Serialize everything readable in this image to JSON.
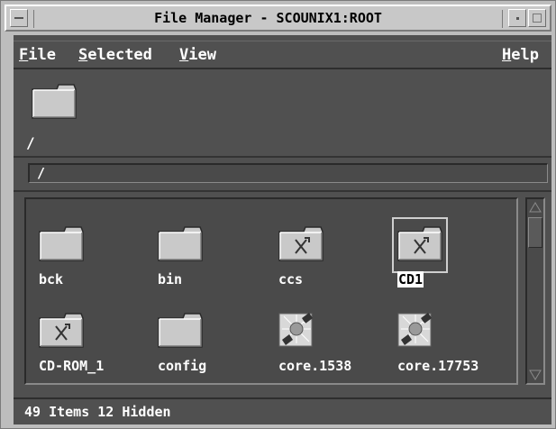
{
  "window": {
    "title": "File Manager - SCOUNIX1:ROOT"
  },
  "menubar": {
    "items": [
      {
        "label": "File",
        "mnemonic": "F",
        "rest": "ile"
      },
      {
        "label": "Selected",
        "mnemonic": "S",
        "rest": "elected"
      },
      {
        "label": "View",
        "mnemonic": "V",
        "rest": "iew"
      },
      {
        "label": "Help",
        "mnemonic": "H",
        "rest": "elp"
      }
    ]
  },
  "location": {
    "current_dir_label": "/",
    "path_value": "/"
  },
  "files": [
    {
      "name": "bck",
      "icon": "folder-icon"
    },
    {
      "name": "bin",
      "icon": "folder-icon"
    },
    {
      "name": "ccs",
      "icon": "linked-folder-icon"
    },
    {
      "name": "CD1",
      "icon": "linked-folder-icon",
      "selected": true
    },
    {
      "name": "CD-ROM_1",
      "icon": "linked-folder-icon"
    },
    {
      "name": "config",
      "icon": "folder-icon"
    },
    {
      "name": "core.1538",
      "icon": "core-dump-icon"
    },
    {
      "name": "core.17753",
      "icon": "core-dump-icon"
    }
  ],
  "status": {
    "text": "49 Items 12 Hidden"
  },
  "colors": {
    "panel_bg": "#505050",
    "frame_bg": "#bdbdbd",
    "text": "#ffffff"
  }
}
